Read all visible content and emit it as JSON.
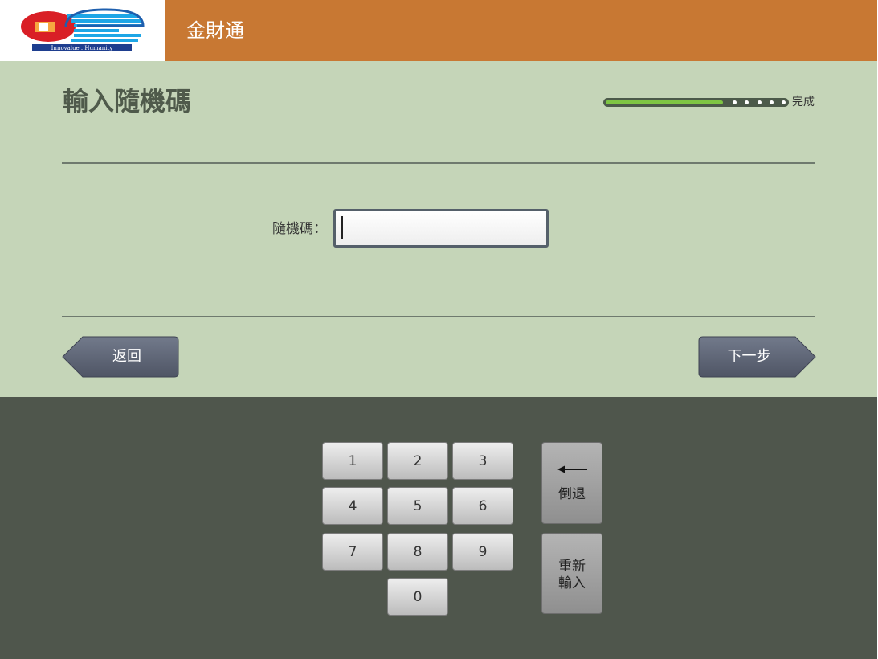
{
  "header": {
    "app_title": "金財通",
    "logo_tagline": "Innovalue . Humanity"
  },
  "page": {
    "title": "輸入隨機碼"
  },
  "progress": {
    "label": "完成",
    "fraction": 0.65,
    "remaining_steps": 5
  },
  "form": {
    "random_code_label": "隨機碼：",
    "random_code_value": "",
    "random_code_placeholder": ""
  },
  "nav": {
    "back_label": "返回",
    "next_label": "下一步"
  },
  "keypad": {
    "keys": [
      "1",
      "2",
      "3",
      "4",
      "5",
      "6",
      "7",
      "8",
      "9",
      "0"
    ],
    "backspace_label": "倒退",
    "reset_label_line1": "重新",
    "reset_label_line2": "輸入"
  },
  "colors": {
    "header_bg": "#c87833",
    "main_bg": "#c5d5b8",
    "keypad_bg": "#4f564c",
    "progress_fill": "#7ec543",
    "nav_button": "#5e6474"
  }
}
